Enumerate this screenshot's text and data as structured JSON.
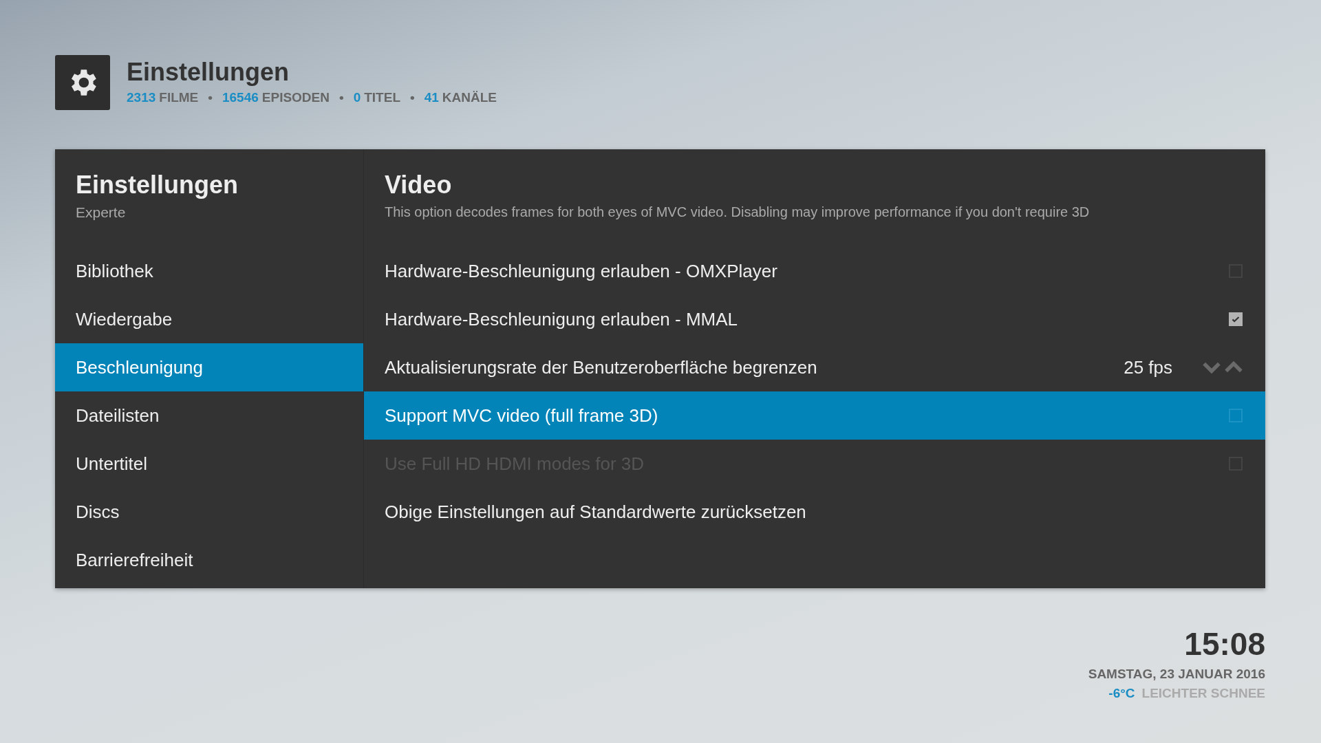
{
  "header": {
    "title": "Einstellungen",
    "stats": [
      {
        "count": "2313",
        "unit": "FILME"
      },
      {
        "count": "16546",
        "unit": "EPISODEN"
      },
      {
        "count": "0",
        "unit": "TITEL"
      },
      {
        "count": "41",
        "unit": "KANÄLE"
      }
    ],
    "separator": "•"
  },
  "sidebar": {
    "title": "Einstellungen",
    "subtitle": "Experte",
    "items": [
      {
        "label": "Bibliothek",
        "selected": false
      },
      {
        "label": "Wiedergabe",
        "selected": false
      },
      {
        "label": "Beschleunigung",
        "selected": true
      },
      {
        "label": "Dateilisten",
        "selected": false
      },
      {
        "label": "Untertitel",
        "selected": false
      },
      {
        "label": "Discs",
        "selected": false
      },
      {
        "label": "Barrierefreiheit",
        "selected": false
      }
    ]
  },
  "content": {
    "title": "Video",
    "description": "This option decodes frames for both eyes of MVC video. Disabling may improve performance if you don't require 3D",
    "settings": [
      {
        "kind": "checkbox",
        "label": "Hardware-Beschleunigung erlauben - OMXPlayer",
        "checked": false,
        "selected": false,
        "disabled": false
      },
      {
        "kind": "checkbox",
        "label": "Hardware-Beschleunigung erlauben - MMAL",
        "checked": true,
        "selected": false,
        "disabled": false
      },
      {
        "kind": "spinner",
        "label": "Aktualisierungsrate der Benutzeroberfläche begrenzen",
        "value": "25 fps",
        "selected": false,
        "disabled": false
      },
      {
        "kind": "checkbox",
        "label": "Support MVC video (full frame 3D)",
        "checked": false,
        "selected": true,
        "disabled": false
      },
      {
        "kind": "checkbox",
        "label": "Use Full HD HDMI modes for 3D",
        "checked": false,
        "selected": false,
        "disabled": true
      },
      {
        "kind": "action",
        "label": "Obige Einstellungen auf Standardwerte zurücksetzen",
        "selected": false,
        "disabled": false
      }
    ]
  },
  "clock": {
    "time": "15:08",
    "date": "SAMSTAG, 23 JANUAR 2016",
    "temperature": "-6°C",
    "condition": "LEICHTER SCHNEE"
  }
}
